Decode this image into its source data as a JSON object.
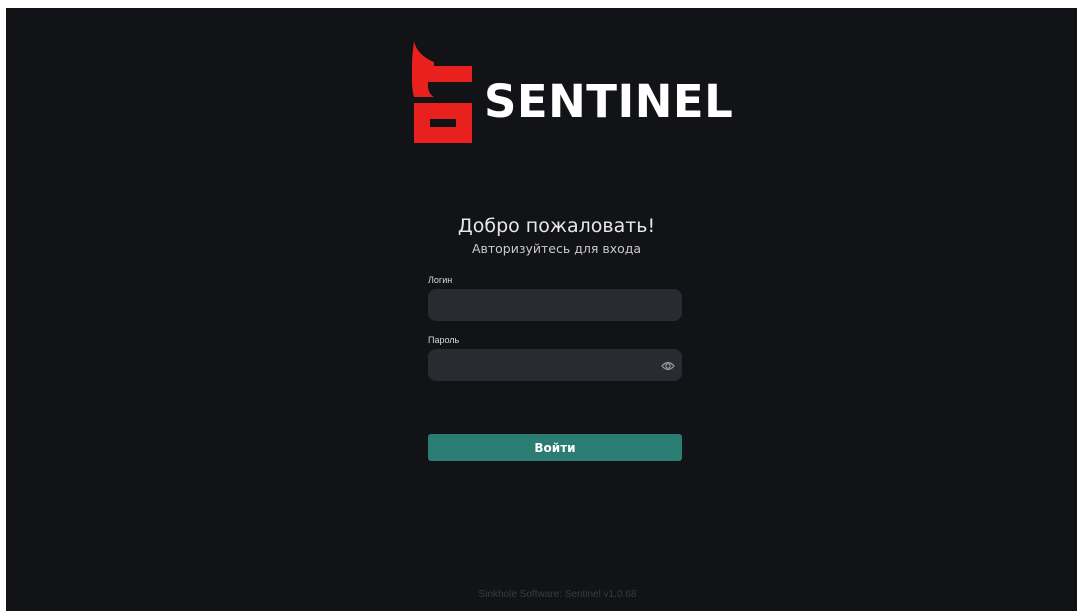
{
  "brand": {
    "name": "SENTINEL",
    "logo_icon": "sentinel-s-logo-icon",
    "logo_color": "#e8211f"
  },
  "login": {
    "title": "Добро пожаловать!",
    "subtitle": "Авторизуйтесь для входа",
    "username_label": "Логин",
    "username_value": "",
    "password_label": "Пароль",
    "password_value": "",
    "toggle_visibility_icon": "eye-icon",
    "submit_label": "Войти",
    "accent_color": "#2b7c72"
  },
  "footer": {
    "text": "Sinkhole Software: Sentinel v1.0.68"
  },
  "colors": {
    "background": "#121317",
    "input_background": "#2a2b30"
  }
}
